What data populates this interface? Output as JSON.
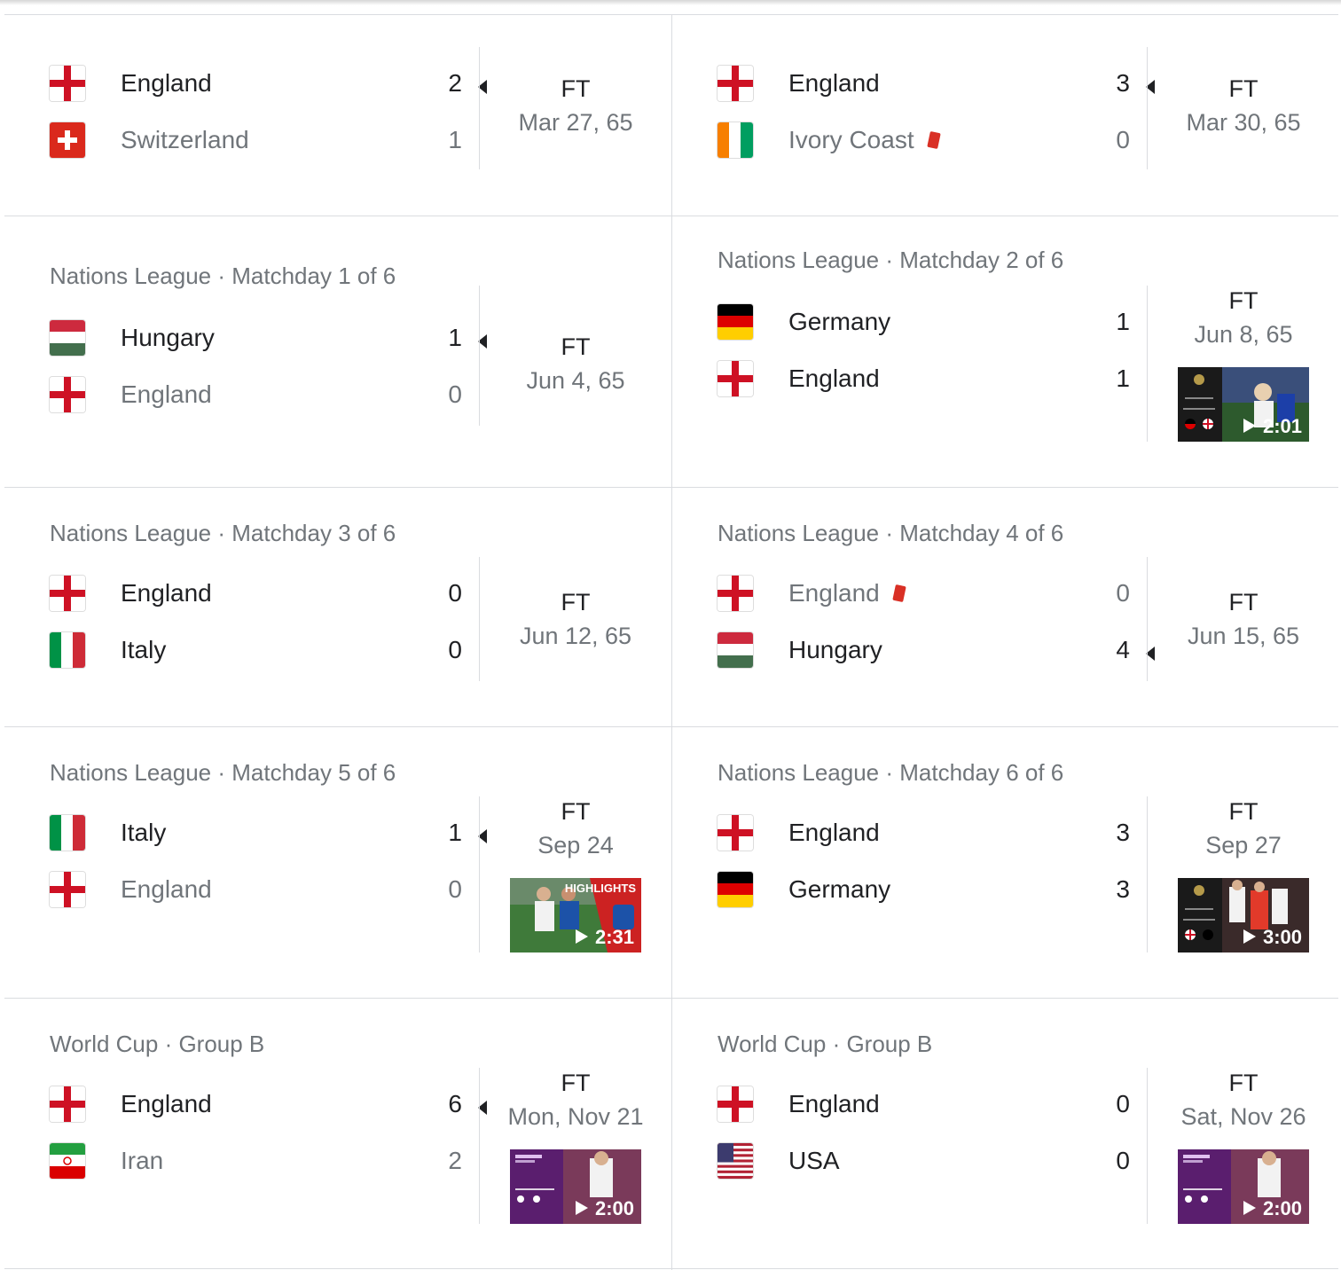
{
  "matches": [
    {
      "competition": "",
      "home": {
        "name": "England",
        "flag": "england",
        "score": "2",
        "winner": true,
        "red_card": false
      },
      "away": {
        "name": "Switzerland",
        "flag": "switzerland",
        "score": "1",
        "winner": false,
        "red_card": false
      },
      "status": "FT",
      "date": "Mar 27, 65",
      "video": null
    },
    {
      "competition": "",
      "home": {
        "name": "England",
        "flag": "england",
        "score": "3",
        "winner": true,
        "red_card": false
      },
      "away": {
        "name": "Ivory Coast",
        "flag": "ivory-coast",
        "score": "0",
        "winner": false,
        "red_card": true
      },
      "status": "FT",
      "date": "Mar 30, 65",
      "video": null
    },
    {
      "competition": "Nations League · Matchday 1 of 6",
      "home": {
        "name": "Hungary",
        "flag": "hungary",
        "score": "1",
        "winner": true,
        "red_card": false
      },
      "away": {
        "name": "England",
        "flag": "england",
        "score": "0",
        "winner": false,
        "red_card": false
      },
      "status": "FT",
      "date": "Jun 4, 65",
      "video": null
    },
    {
      "competition": "Nations League · Matchday 2 of 6",
      "home": {
        "name": "Germany",
        "flag": "germany",
        "score": "1",
        "winner": false,
        "draw": true,
        "red_card": false
      },
      "away": {
        "name": "England",
        "flag": "england",
        "score": "1",
        "winner": false,
        "draw": true,
        "red_card": false
      },
      "status": "FT",
      "date": "Jun 8, 65",
      "video": {
        "duration": "2:01",
        "style": "nations-ger-eng"
      }
    },
    {
      "competition": "Nations League · Matchday 3 of 6",
      "home": {
        "name": "England",
        "flag": "england",
        "score": "0",
        "winner": false,
        "draw": true,
        "red_card": false
      },
      "away": {
        "name": "Italy",
        "flag": "italy",
        "score": "0",
        "winner": false,
        "draw": true,
        "red_card": false
      },
      "status": "FT",
      "date": "Jun 12, 65",
      "video": null
    },
    {
      "competition": "Nations League · Matchday 4 of 6",
      "home": {
        "name": "England",
        "flag": "england",
        "score": "0",
        "winner": false,
        "red_card": true
      },
      "away": {
        "name": "Hungary",
        "flag": "hungary",
        "score": "4",
        "winner": true,
        "red_card": false
      },
      "status": "FT",
      "date": "Jun 15, 65",
      "video": null
    },
    {
      "competition": "Nations League · Matchday 5 of 6",
      "home": {
        "name": "Italy",
        "flag": "italy",
        "score": "1",
        "winner": true,
        "red_card": false
      },
      "away": {
        "name": "England",
        "flag": "england",
        "score": "0",
        "winner": false,
        "red_card": false
      },
      "status": "FT",
      "date": "Sep 24",
      "video": {
        "duration": "2:31",
        "style": "italy-highlights",
        "overlay_text": "HIGHLIGHTS"
      }
    },
    {
      "competition": "Nations League · Matchday 6 of 6",
      "home": {
        "name": "England",
        "flag": "england",
        "score": "3",
        "winner": false,
        "draw": true,
        "red_card": false
      },
      "away": {
        "name": "Germany",
        "flag": "germany",
        "score": "3",
        "winner": false,
        "draw": true,
        "red_card": false
      },
      "status": "FT",
      "date": "Sep 27",
      "video": {
        "duration": "3:00",
        "style": "nations-eng-ger"
      }
    },
    {
      "competition": "World Cup · Group B",
      "home": {
        "name": "England",
        "flag": "england",
        "score": "6",
        "winner": true,
        "red_card": false
      },
      "away": {
        "name": "Iran",
        "flag": "iran",
        "score": "2",
        "winner": false,
        "red_card": false
      },
      "status": "FT",
      "date": "Mon, Nov 21",
      "video": {
        "duration": "2:00",
        "style": "worldcup"
      }
    },
    {
      "competition": "World Cup · Group B",
      "home": {
        "name": "England",
        "flag": "england",
        "score": "0",
        "winner": false,
        "draw": true,
        "red_card": false
      },
      "away": {
        "name": "USA",
        "flag": "usa",
        "score": "0",
        "winner": false,
        "draw": true,
        "red_card": false
      },
      "status": "FT",
      "date": "Sat, Nov 26",
      "video": {
        "duration": "2:00",
        "style": "worldcup"
      }
    }
  ],
  "colors": {
    "text": "#202124",
    "muted": "#70757a",
    "divider": "#dadce0",
    "red_card": "#d93025"
  }
}
